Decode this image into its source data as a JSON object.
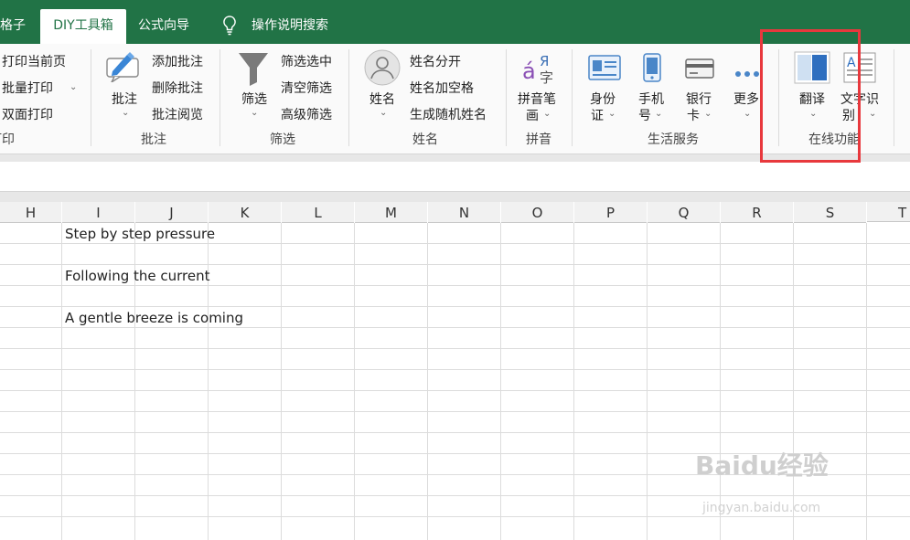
{
  "tabs": {
    "partial_left": "格子",
    "active": "DIY工具箱",
    "formula": "公式向导",
    "search": "操作说明搜索"
  },
  "ribbon": {
    "print": {
      "items": [
        "打印当前页",
        "批量打印",
        "双面打印"
      ],
      "group_label": "打印"
    },
    "comment": {
      "big_label": "批注",
      "items": [
        "添加批注",
        "删除批注",
        "批注阅览"
      ],
      "group_label": "批注"
    },
    "filter": {
      "big_label": "筛选",
      "items": [
        "筛选选中",
        "清空筛选",
        "高级筛选"
      ],
      "group_label": "筛选"
    },
    "name": {
      "big_label": "姓名",
      "items": [
        "姓名分开",
        "姓名加空格",
        "生成随机姓名"
      ],
      "group_label": "姓名"
    },
    "pinyin": {
      "big_label_1": "拼音笔",
      "big_label_2": "画",
      "group_label": "拼音"
    },
    "life": {
      "id_1": "身份",
      "id_2": "证",
      "phone_1": "手机",
      "phone_2": "号",
      "bank_1": "银行",
      "bank_2": "卡",
      "more": "更多",
      "group_label": "生活服务"
    },
    "online": {
      "translate": "翻译",
      "ocr_1": "文字识",
      "ocr_2": "别",
      "group_label": "在线功能"
    }
  },
  "columns": [
    "H",
    "I",
    "J",
    "K",
    "L",
    "M",
    "N",
    "O",
    "P",
    "Q",
    "R",
    "S",
    "T"
  ],
  "cells": {
    "row1": "Step by step pressure",
    "row3": "Following the current",
    "row5": "A gentle breeze is coming"
  },
  "watermark": {
    "main": "Baidu经验",
    "sub": "jingyan.baidu.com"
  },
  "colors": {
    "accent": "#217346",
    "highlight": "#e8383d"
  }
}
